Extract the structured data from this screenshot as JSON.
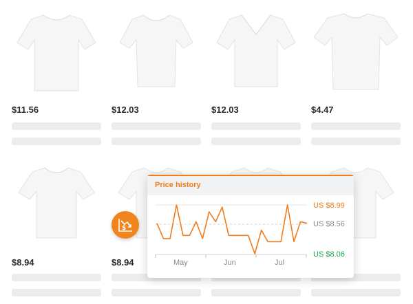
{
  "products": [
    {
      "price": "$11.56",
      "icon": "tshirt-short-sleeve"
    },
    {
      "price": "$12.03",
      "icon": "tshirt-fitted"
    },
    {
      "price": "$12.03",
      "icon": "tshirt-v-neck"
    },
    {
      "price": "$4.47",
      "icon": "tshirt-boxy"
    },
    {
      "price": "$8.94",
      "icon": "tshirt-short-sleeve"
    },
    {
      "price": "$8.94",
      "icon": "tshirt-short-sleeve"
    }
  ],
  "price_history": {
    "title": "Price history",
    "max_label": "US $8.99",
    "mid_label": "US $8.56",
    "min_label": "US $8.06",
    "months": [
      "May",
      "Jun",
      "Jul"
    ],
    "badge_icon": "price-drop-chart-icon",
    "colors": {
      "accent": "#f07c1b",
      "low": "#1aa34a",
      "axis": "#8a8a8a"
    }
  },
  "chart_data": {
    "type": "line",
    "x_ticks": [
      "May",
      "Jun",
      "Jul"
    ],
    "ylim": [
      8.06,
      8.99
    ],
    "series": [
      {
        "values": [
          8.64,
          8.35,
          8.35,
          8.99,
          8.41,
          8.41,
          8.67,
          8.35,
          8.86,
          8.67,
          8.95,
          8.41,
          8.41,
          8.41,
          8.41,
          8.06,
          8.51,
          8.29,
          8.29,
          8.29,
          8.99,
          8.29,
          8.67,
          8.64
        ]
      }
    ],
    "grid": true
  }
}
